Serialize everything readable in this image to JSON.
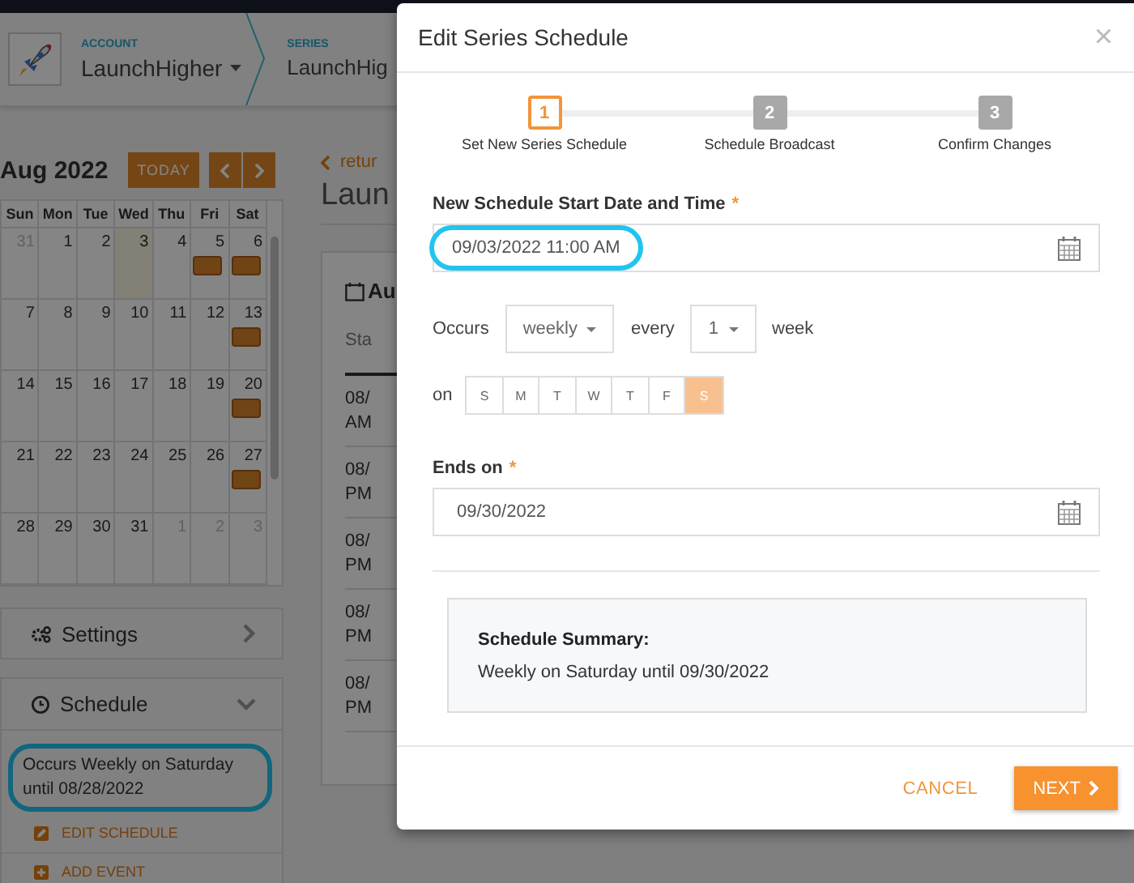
{
  "header": {
    "account_label": "ACCOUNT",
    "account_name": "LaunchHigher",
    "series_label": "SERIES",
    "series_name": "LaunchHig"
  },
  "calendar": {
    "title": "Aug 2022",
    "today_button": "TODAY",
    "weekdays": [
      "Sun",
      "Mon",
      "Tue",
      "Wed",
      "Thu",
      "Fri",
      "Sat"
    ],
    "weeks": [
      [
        {
          "day": "31",
          "outside": true,
          "today": false,
          "event": false
        },
        {
          "day": "1",
          "outside": false,
          "today": false,
          "event": false
        },
        {
          "day": "2",
          "outside": false,
          "today": false,
          "event": false
        },
        {
          "day": "3",
          "outside": false,
          "today": true,
          "event": false
        },
        {
          "day": "4",
          "outside": false,
          "today": false,
          "event": false
        },
        {
          "day": "5",
          "outside": false,
          "today": false,
          "event": true
        },
        {
          "day": "6",
          "outside": false,
          "today": false,
          "event": true
        }
      ],
      [
        {
          "day": "7",
          "outside": false,
          "today": false,
          "event": false
        },
        {
          "day": "8",
          "outside": false,
          "today": false,
          "event": false
        },
        {
          "day": "9",
          "outside": false,
          "today": false,
          "event": false
        },
        {
          "day": "10",
          "outside": false,
          "today": false,
          "event": false
        },
        {
          "day": "11",
          "outside": false,
          "today": false,
          "event": false
        },
        {
          "day": "12",
          "outside": false,
          "today": false,
          "event": false
        },
        {
          "day": "13",
          "outside": false,
          "today": false,
          "event": true
        }
      ],
      [
        {
          "day": "14",
          "outside": false,
          "today": false,
          "event": false
        },
        {
          "day": "15",
          "outside": false,
          "today": false,
          "event": false
        },
        {
          "day": "16",
          "outside": false,
          "today": false,
          "event": false
        },
        {
          "day": "17",
          "outside": false,
          "today": false,
          "event": false
        },
        {
          "day": "18",
          "outside": false,
          "today": false,
          "event": false
        },
        {
          "day": "19",
          "outside": false,
          "today": false,
          "event": false
        },
        {
          "day": "20",
          "outside": false,
          "today": false,
          "event": true
        }
      ],
      [
        {
          "day": "21",
          "outside": false,
          "today": false,
          "event": false
        },
        {
          "day": "22",
          "outside": false,
          "today": false,
          "event": false
        },
        {
          "day": "23",
          "outside": false,
          "today": false,
          "event": false
        },
        {
          "day": "24",
          "outside": false,
          "today": false,
          "event": false
        },
        {
          "day": "25",
          "outside": false,
          "today": false,
          "event": false
        },
        {
          "day": "26",
          "outside": false,
          "today": false,
          "event": false
        },
        {
          "day": "27",
          "outside": false,
          "today": false,
          "event": true
        }
      ],
      [
        {
          "day": "28",
          "outside": false,
          "today": false,
          "event": false
        },
        {
          "day": "29",
          "outside": false,
          "today": false,
          "event": false
        },
        {
          "day": "30",
          "outside": false,
          "today": false,
          "event": false
        },
        {
          "day": "31",
          "outside": false,
          "today": false,
          "event": false
        },
        {
          "day": "1",
          "outside": true,
          "today": false,
          "event": false
        },
        {
          "day": "2",
          "outside": true,
          "today": false,
          "event": false
        },
        {
          "day": "3",
          "outside": true,
          "today": false,
          "event": false
        }
      ]
    ]
  },
  "settings_panel": {
    "title": "Settings",
    "expanded": false
  },
  "schedule_panel": {
    "title": "Schedule",
    "expanded": true,
    "description": "Occurs Weekly on Saturday until 08/28/2022",
    "highlighted": true,
    "actions": [
      {
        "label": "EDIT SCHEDULE",
        "kind": "edit"
      },
      {
        "label": "ADD EVENT",
        "kind": "add"
      }
    ]
  },
  "series_page": {
    "back_link": "retur",
    "title": "Laun",
    "card_title": "Au",
    "column_1": "Sta",
    "rows": [
      {
        "line_1": "08/",
        "line_2": "AM"
      },
      {
        "line_1": "08/",
        "line_2": "PM"
      },
      {
        "line_1": "08/",
        "line_2": "PM"
      },
      {
        "line_1": "08/",
        "line_2": "PM"
      },
      {
        "line_1": "08/",
        "line_2": "PM"
      }
    ]
  },
  "modal": {
    "title": "Edit Series Schedule",
    "close": "×",
    "steps": [
      {
        "number": "1",
        "label": "Set New Series Schedule",
        "selected": true
      },
      {
        "number": "2",
        "label": "Schedule Broadcast",
        "selected": false
      },
      {
        "number": "3",
        "label": "Confirm Changes",
        "selected": false
      }
    ],
    "start": {
      "label": "New Schedule Start Date and Time",
      "required": true,
      "required_mark": "*",
      "value": "09/03/2022 11:00 AM",
      "highlighted": true
    },
    "occurs": {
      "label": "Occurs",
      "frequency": "weekly",
      "every_label": "every",
      "interval": "1",
      "unit": "week"
    },
    "on_label": "on",
    "days": [
      {
        "label": "S",
        "selected": false
      },
      {
        "label": "M",
        "selected": false
      },
      {
        "label": "T",
        "selected": false
      },
      {
        "label": "W",
        "selected": false
      },
      {
        "label": "T",
        "selected": false
      },
      {
        "label": "F",
        "selected": false
      },
      {
        "label": "S",
        "selected": true
      }
    ],
    "ends": {
      "label": "Ends on",
      "required": true,
      "required_mark": "*",
      "value": "09/30/2022",
      "highlighted": false
    },
    "summary": {
      "title": "Schedule Summary:",
      "text": "Weekly on Saturday until 09/30/2022"
    },
    "cancel": "CANCEL",
    "next": "NEXT"
  }
}
